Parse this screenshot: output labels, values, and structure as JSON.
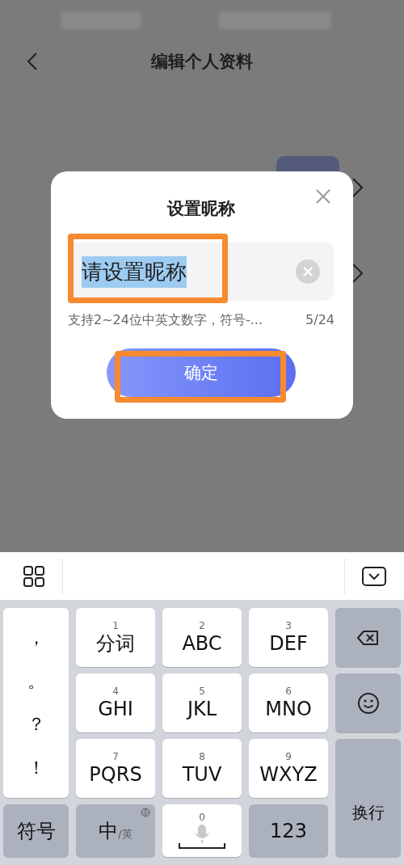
{
  "header": {
    "title": "编辑个人资料"
  },
  "dialog": {
    "title": "设置昵称",
    "input": {
      "value": "请设置昵称",
      "text_selected": true
    },
    "hint": "支持2~24位中英文数字，符号-...",
    "count": "5/24",
    "confirm": "确定"
  },
  "keyboard": {
    "punctuation": [
      "，",
      "。",
      "？",
      "！"
    ],
    "keys": [
      {
        "digit": "1",
        "label": "分词"
      },
      {
        "digit": "2",
        "label": "ABC"
      },
      {
        "digit": "3",
        "label": "DEF"
      },
      {
        "digit": "4",
        "label": "GHI"
      },
      {
        "digit": "5",
        "label": "JKL"
      },
      {
        "digit": "6",
        "label": "MNO"
      },
      {
        "digit": "7",
        "label": "PQRS"
      },
      {
        "digit": "8",
        "label": "TUV"
      },
      {
        "digit": "9",
        "label": "WXYZ"
      }
    ],
    "bottom_keys": [
      {
        "kind": "text",
        "label": "符号"
      },
      {
        "kind": "lang",
        "label": "中",
        "sublabel": "/英"
      },
      {
        "kind": "space",
        "digit": "0"
      },
      {
        "kind": "text",
        "label": "123"
      }
    ],
    "side_keys": [
      {
        "kind": "backspace"
      },
      {
        "kind": "emoji"
      },
      {
        "kind": "enter",
        "label": "换行"
      }
    ]
  }
}
